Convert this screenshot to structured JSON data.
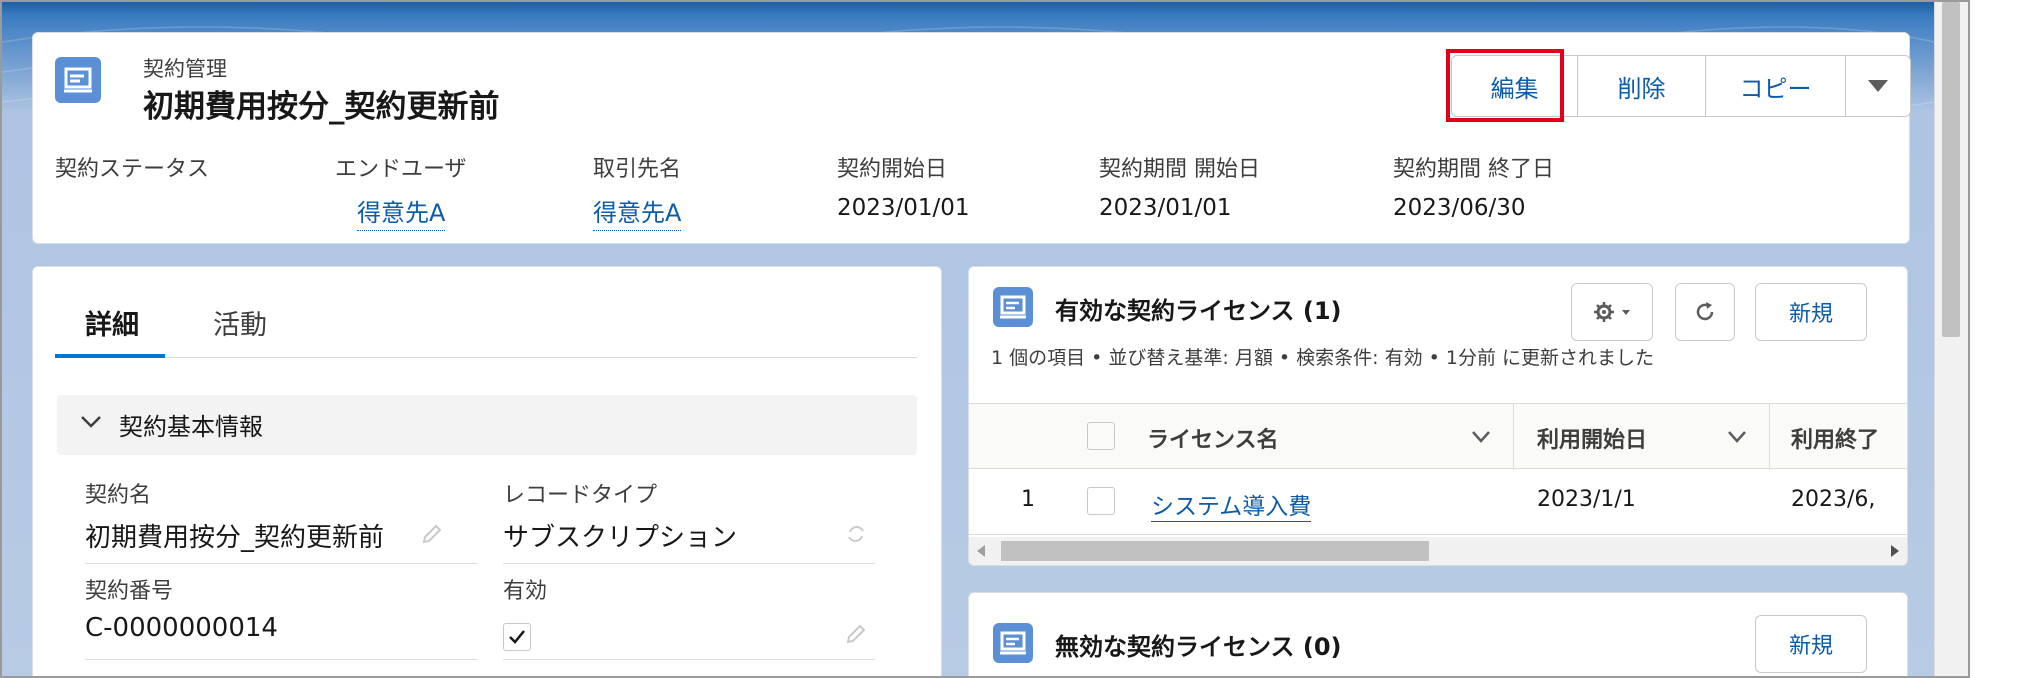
{
  "header": {
    "object_label": "契約管理",
    "record_title": "初期費用按分_契約更新前",
    "actions": {
      "edit": "編集",
      "delete": "削除",
      "copy": "コピー",
      "more_icon": "chevron-down-icon"
    },
    "fields": [
      {
        "label": "契約ステータス",
        "value": ""
      },
      {
        "label": "エンドユーザ",
        "value": "得意先A"
      },
      {
        "label": "取引先名",
        "value": "得意先A"
      },
      {
        "label": "契約開始日",
        "value": "2023/01/01"
      },
      {
        "label": "契約期間 開始日",
        "value": "2023/01/01"
      },
      {
        "label": "契約期間 終了日",
        "value": "2023/06/30"
      }
    ]
  },
  "detail": {
    "tabs": [
      "詳細",
      "活動"
    ],
    "section_title": "契約基本情報",
    "fields": {
      "contract_name_label": "契約名",
      "contract_name_value": "初期費用按分_契約更新前",
      "record_type_label": "レコードタイプ",
      "record_type_value": "サブスクリプション",
      "contract_number_label": "契約番号",
      "contract_number_value": "C-0000000014",
      "active_label": "有効",
      "active_checked": true
    }
  },
  "related_active": {
    "title": "有効な契約ライセンス (1)",
    "subtitle": "1 個の項目 • 並び替え基準: 月額 • 検索条件: 有効 • 1分前 に更新されました",
    "new_button": "新規",
    "columns": [
      "ライセンス名",
      "利用開始日",
      "利用終了"
    ],
    "rows": [
      {
        "num": "1",
        "name": "システム導入費",
        "start": "2023/1/1",
        "end": "2023/6,"
      }
    ]
  },
  "related_inactive": {
    "title": "無効な契約ライセンス (0)",
    "new_button": "新規"
  },
  "colors": {
    "brand_blue": "#0b5cab",
    "icon_blue": "#5b8fd6",
    "highlight_red": "#e4001b"
  }
}
